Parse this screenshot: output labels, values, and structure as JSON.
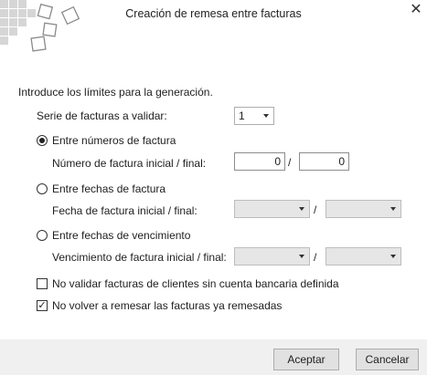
{
  "window": {
    "title": "Creación de remesa entre facturas"
  },
  "intro": "Introduce los límites para la generación.",
  "serie": {
    "label": "Serie de facturas a validar:",
    "value": "1"
  },
  "options": {
    "numeros": {
      "label": "Entre números de factura",
      "checked": true,
      "field_label": "Número de factura inicial / final:",
      "start": "0",
      "end": "0",
      "separator": "/"
    },
    "fechas": {
      "label": "Entre fechas de factura",
      "checked": false,
      "field_label": "Fecha de factura inicial / final:",
      "separator": "/"
    },
    "vencimiento": {
      "label": "Entre fechas de vencimiento",
      "checked": false,
      "field_label": "Vencimiento de factura inicial / final:",
      "separator": "/"
    }
  },
  "checks": {
    "no_validar": {
      "label": "No validar facturas de clientes sin cuenta bancaria definida",
      "checked": false
    },
    "no_volver": {
      "label": "No volver a remesar las facturas ya remesadas",
      "checked": true,
      "mark": "✓"
    }
  },
  "buttons": {
    "accept": "Aceptar",
    "cancel": "Cancelar"
  },
  "close_glyph": "✕"
}
